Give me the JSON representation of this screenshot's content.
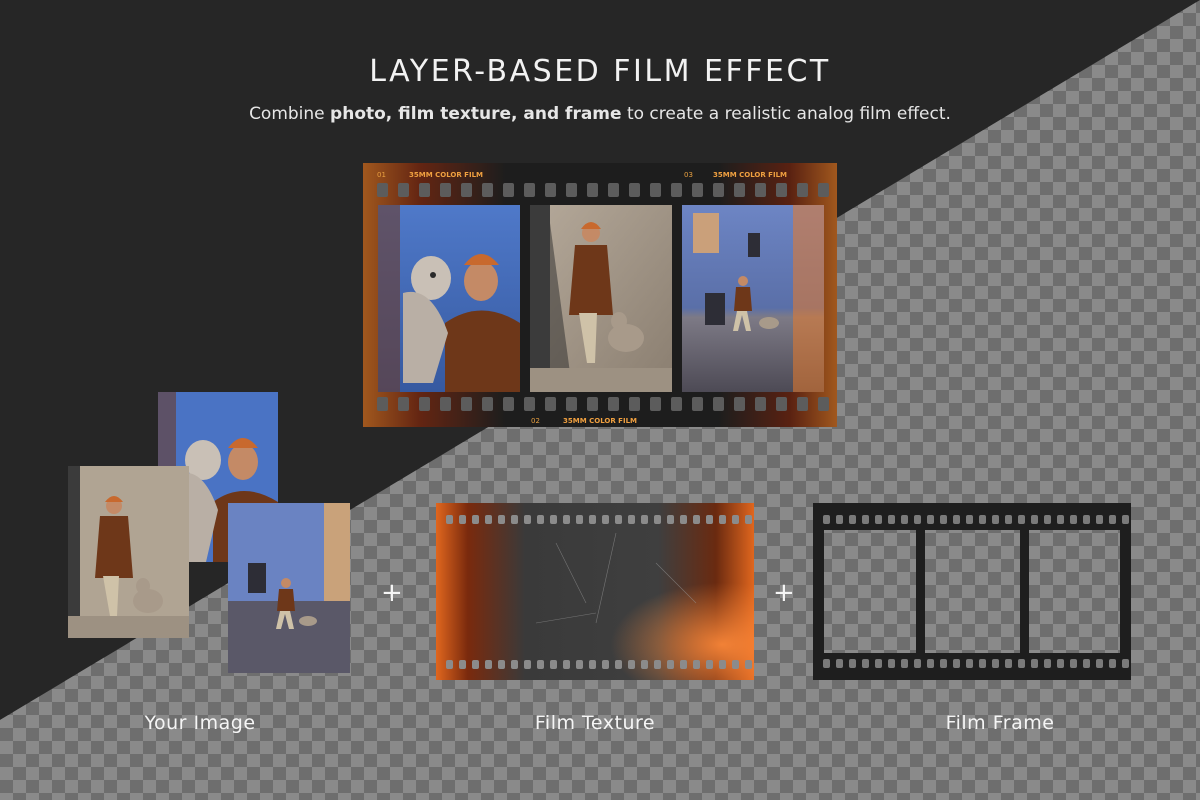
{
  "header": {
    "title": "LAYER-BASED FILM EFFECT",
    "subtitle_before": "Combine ",
    "subtitle_bold": "photo, film texture, and frame",
    "subtitle_after": " to create a realistic analog film effect."
  },
  "hero": {
    "frame_label_left": "35MM COLOR FILM",
    "frame_label_right": "35MM COLOR FILM",
    "frame_label_bottom": "35MM COLOR FILM",
    "num_1": "01",
    "num_2": "02",
    "num_3": "03"
  },
  "steps": {
    "image_label": "Your Image",
    "texture_label": "Film Texture",
    "frame_label": "Film Frame",
    "plus_1": "+",
    "plus_2": "+"
  },
  "colors": {
    "background": "#262626",
    "film_black": "#1e1e1e",
    "film_orange": "#e0661e",
    "label_orange": "#f0a040"
  }
}
